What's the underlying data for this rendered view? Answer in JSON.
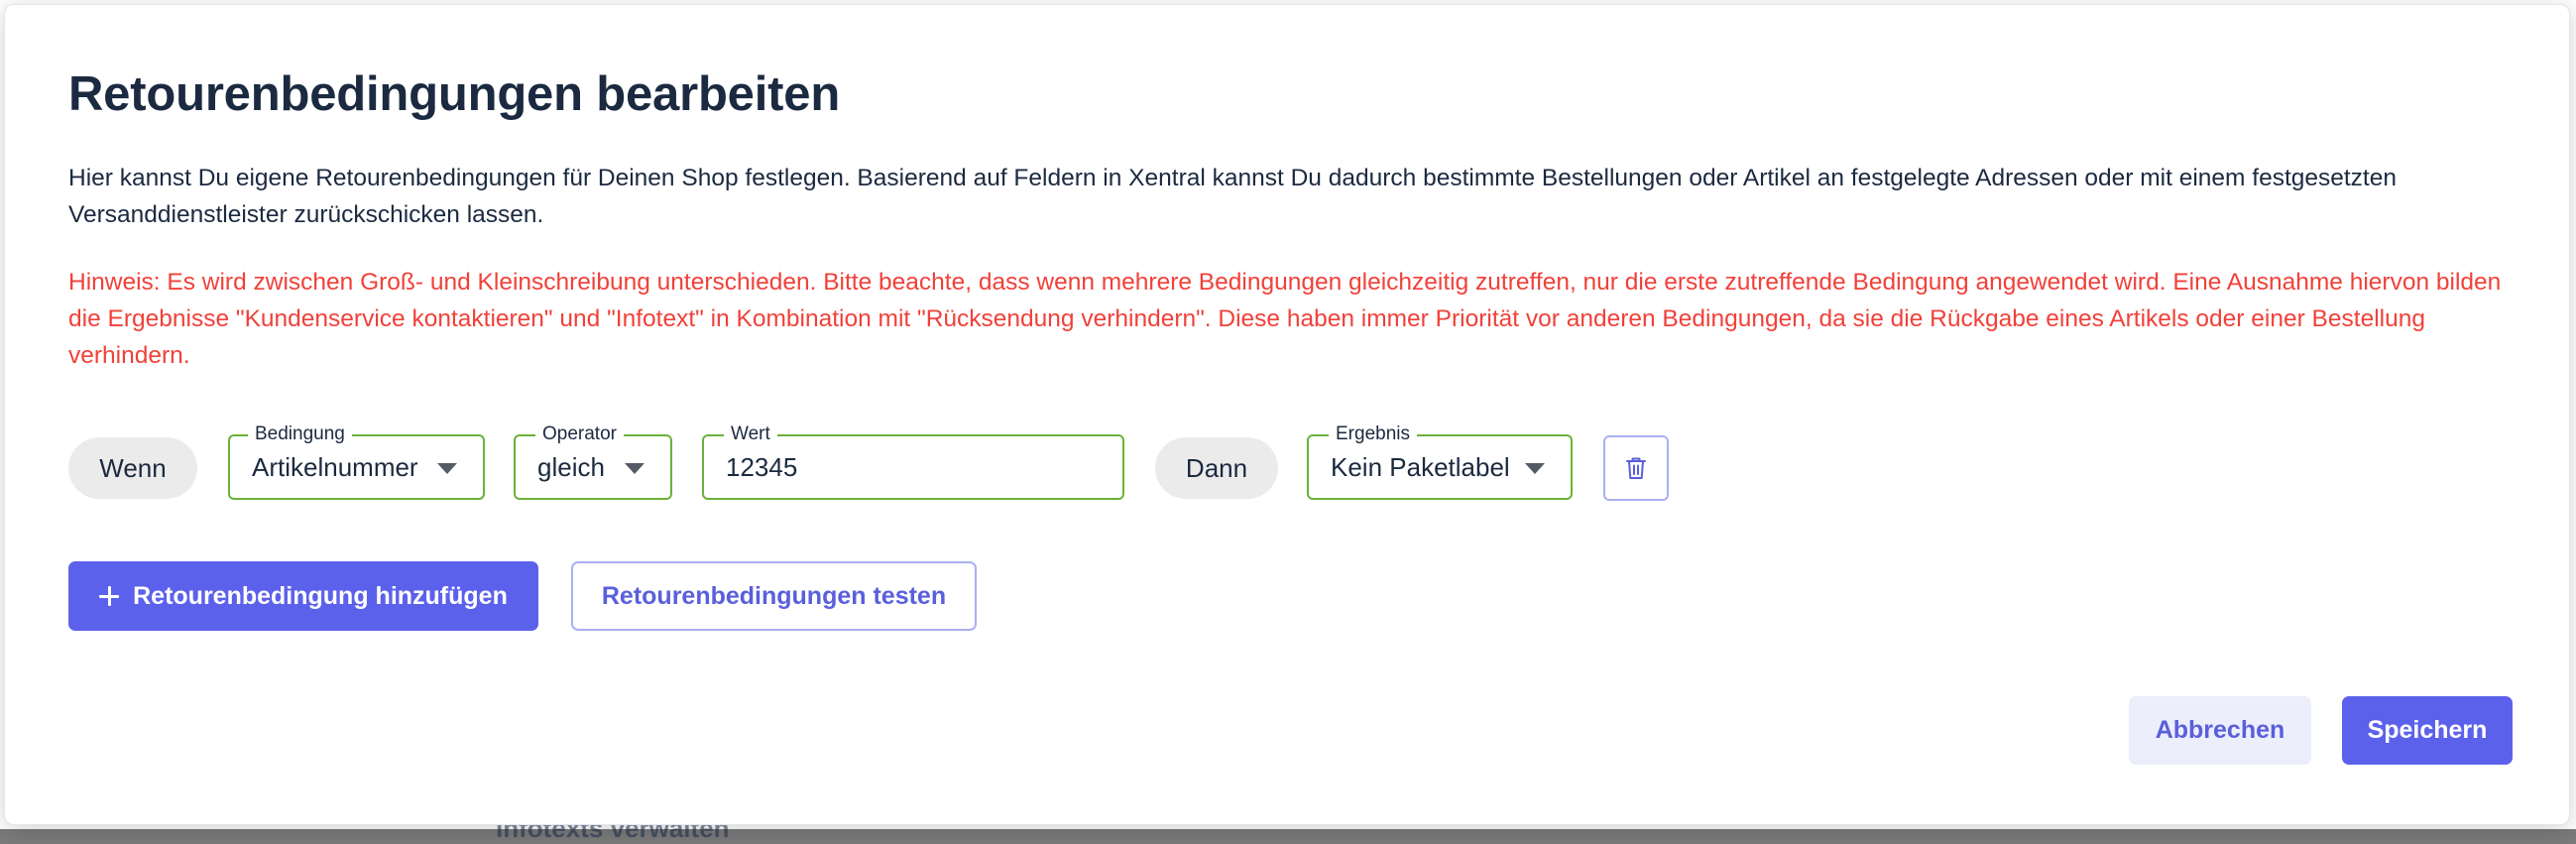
{
  "background": {
    "peek_text": "Infotexts verwalten"
  },
  "dialog": {
    "title": "Retourenbedingungen bearbeiten",
    "description": "Hier kannst Du eigene Retourenbedingungen für Deinen Shop festlegen. Basierend auf Feldern in Xentral kannst Du dadurch bestimmte Bestellungen oder Artikel an festgelegte Adressen oder mit einem festgesetzten Versanddienstleister zurückschicken lassen.",
    "hint": "Hinweis: Es wird zwischen Groß- und Kleinschreibung unterschieden. Bitte beachte, dass wenn mehrere Bedingungen gleichzeitig zutreffen, nur die erste zutreffende Bedingung angewendet wird. Eine Ausnahme hiervon bilden die Ergebnisse \"Kundenservice kontaktieren\" und \"Infotext\" in Kombination mit \"Rücksendung verhindern\". Diese haben immer Priorität vor anderen Bedingungen, da sie die Rückgabe eines Artikels oder einer Bestellung verhindern."
  },
  "rule": {
    "if_label": "Wenn",
    "condition": {
      "label": "Bedingung",
      "value": "Artikelnummer"
    },
    "operator": {
      "label": "Operator",
      "value": "gleich"
    },
    "wert": {
      "label": "Wert",
      "value": "12345"
    },
    "then_label": "Dann",
    "result": {
      "label": "Ergebnis",
      "value": "Kein Paketlabel"
    }
  },
  "actions": {
    "add_label": "Retourenbedingung hinzufügen",
    "test_label": "Retourenbedingungen testen"
  },
  "footer": {
    "cancel_label": "Abbrechen",
    "save_label": "Speichern"
  },
  "colors": {
    "primary": "#5c61ec",
    "hint_red": "#f0413a",
    "field_border_valid": "#6ab23a",
    "title_text": "#1b2a40"
  }
}
